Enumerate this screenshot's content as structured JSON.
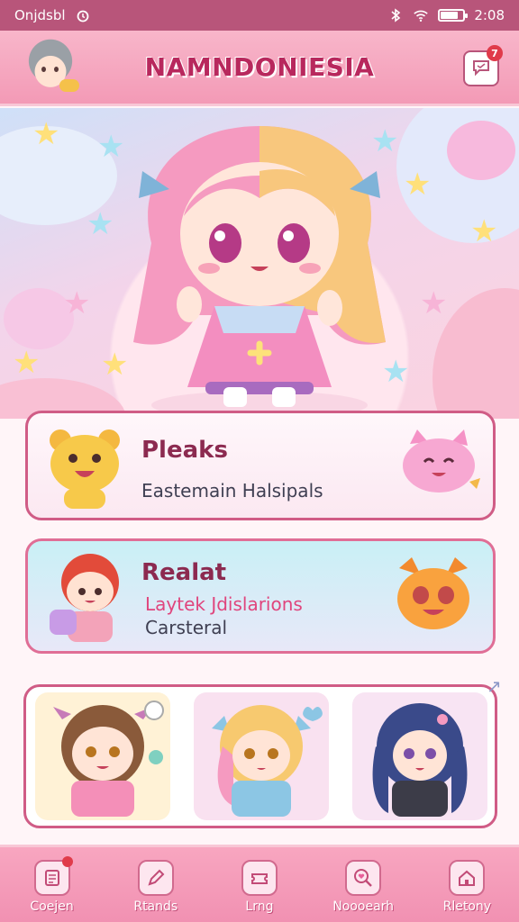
{
  "status_bar": {
    "carrier": "Onjdsbl",
    "time": "2:08",
    "battery_level": 0.8
  },
  "header": {
    "title": "NAMNDONIESIA",
    "notification_count": "7"
  },
  "cards": [
    {
      "title": "Pleaks",
      "subtitle": "Eastemain Halsipals"
    },
    {
      "title": "Realat",
      "subtitle_accent": "Laytek Jdislarions",
      "subtitle": "Carsteral"
    }
  ],
  "bottom_nav": {
    "items": [
      {
        "label": "Coejen",
        "icon": "document-icon",
        "badge": true
      },
      {
        "label": "Rtands",
        "icon": "pencil-icon",
        "badge": false
      },
      {
        "label": "Lrng",
        "icon": "ticket-icon",
        "badge": false
      },
      {
        "label": "Noooearh",
        "icon": "heart-search-icon",
        "badge": false
      },
      {
        "label": "Rletony",
        "icon": "home-icon",
        "badge": false
      }
    ]
  },
  "colors": {
    "accent": "#d05c86",
    "header": "#f39ab6",
    "status_bar": "#b8557a"
  }
}
